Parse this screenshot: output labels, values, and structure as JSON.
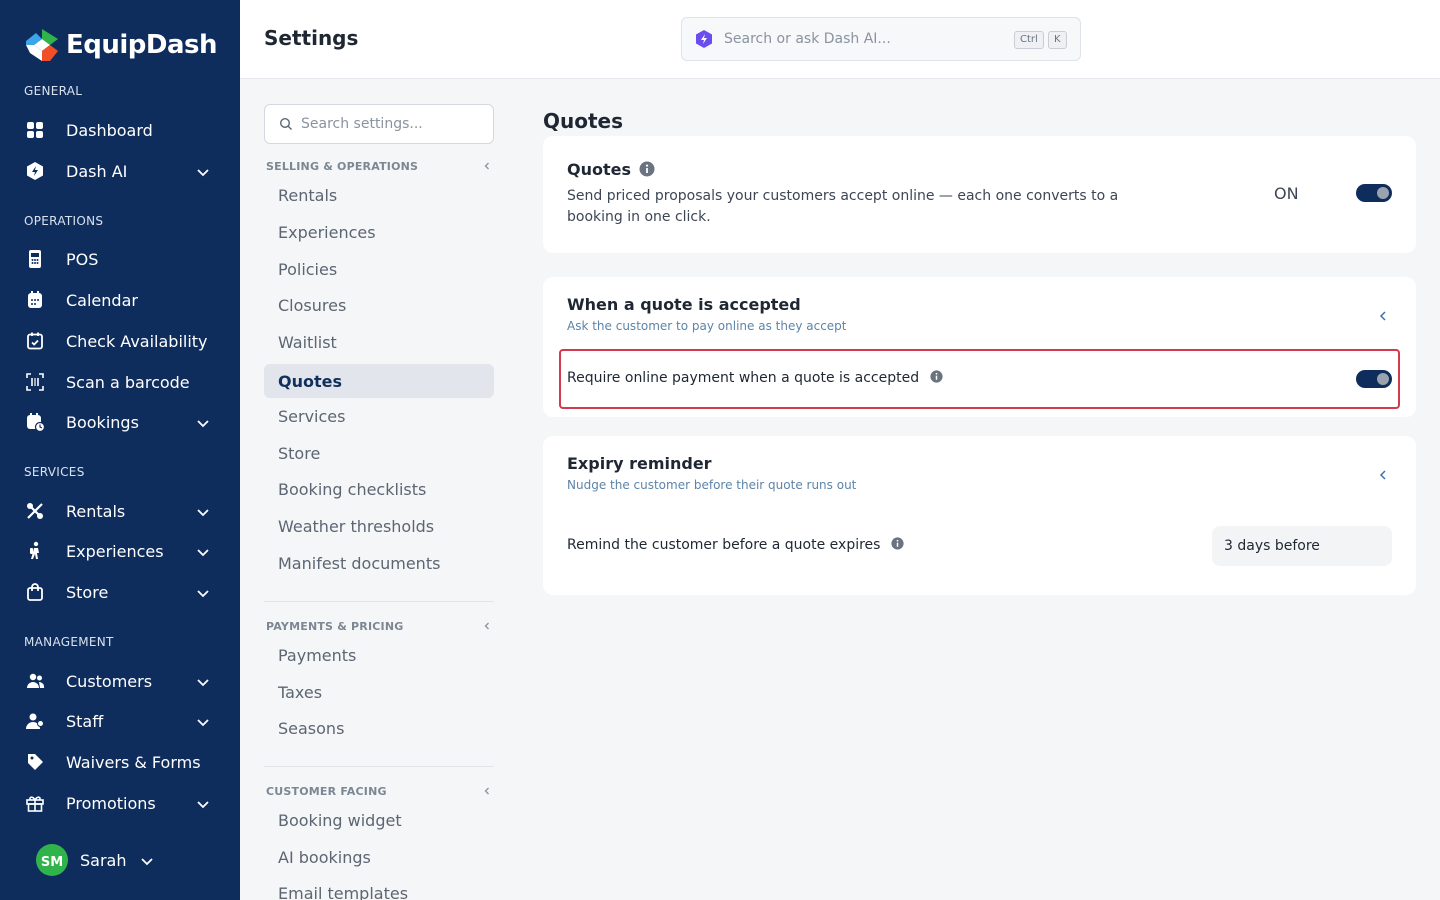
{
  "app": {
    "name": "EquipDash"
  },
  "sidebar": {
    "sections": {
      "general": "GENERAL",
      "operations": "OPERATIONS",
      "services": "SERVICES",
      "management": "MANAGEMENT"
    },
    "items": {
      "dashboard": "Dashboard",
      "dash_ai": "Dash AI",
      "pos": "POS",
      "calendar": "Calendar",
      "check_availability": "Check Availability",
      "scan_barcode": "Scan a barcode",
      "bookings": "Bookings",
      "rentals": "Rentals",
      "experiences": "Experiences",
      "store": "Store",
      "customers": "Customers",
      "staff": "Staff",
      "waivers_forms": "Waivers & Forms",
      "promotions": "Promotions"
    },
    "user": {
      "initials": "SM",
      "name": "Sarah"
    }
  },
  "header": {
    "title": "Settings",
    "search_placeholder": "Search or ask Dash AI...",
    "kbd_ctrl": "Ctrl",
    "kbd_k": "K"
  },
  "settings_nav": {
    "search_placeholder": "Search settings...",
    "groups": {
      "selling": "SELLING & OPERATIONS",
      "payments": "PAYMENTS & PRICING",
      "customer": "CUSTOMER FACING"
    },
    "items": {
      "rentals": "Rentals",
      "experiences": "Experiences",
      "policies": "Policies",
      "closures": "Closures",
      "waitlist": "Waitlist",
      "quotes": "Quotes",
      "services": "Services",
      "store": "Store",
      "booking_checklists": "Booking checklists",
      "weather_thresholds": "Weather thresholds",
      "manifest_documents": "Manifest documents",
      "payments": "Payments",
      "taxes": "Taxes",
      "seasons": "Seasons",
      "booking_widget": "Booking widget",
      "ai_bookings": "AI bookings",
      "email_templates": "Email templates"
    },
    "active": "quotes"
  },
  "main": {
    "section_title": "Quotes",
    "quotes_card": {
      "title": "Quotes",
      "description": "Send priced proposals your customers accept online — each one converts to a booking in one click.",
      "state_label": "ON",
      "enabled": true
    },
    "accepted_card": {
      "title": "When a quote is accepted",
      "subtitle": "Ask the customer to pay online as they accept",
      "row_label": "Require online payment when a quote is accepted",
      "enabled": true
    },
    "expiry_card": {
      "title": "Expiry reminder",
      "subtitle": "Nudge the customer before their quote runs out",
      "row_label": "Remind the customer before a quote expires",
      "selected_value": "3 days before"
    }
  },
  "colors": {
    "sidebar_bg": "#0f2d5c",
    "accent": "#0f2d5c",
    "highlight_border": "#d23a4e",
    "avatar": "#2fb34a"
  }
}
